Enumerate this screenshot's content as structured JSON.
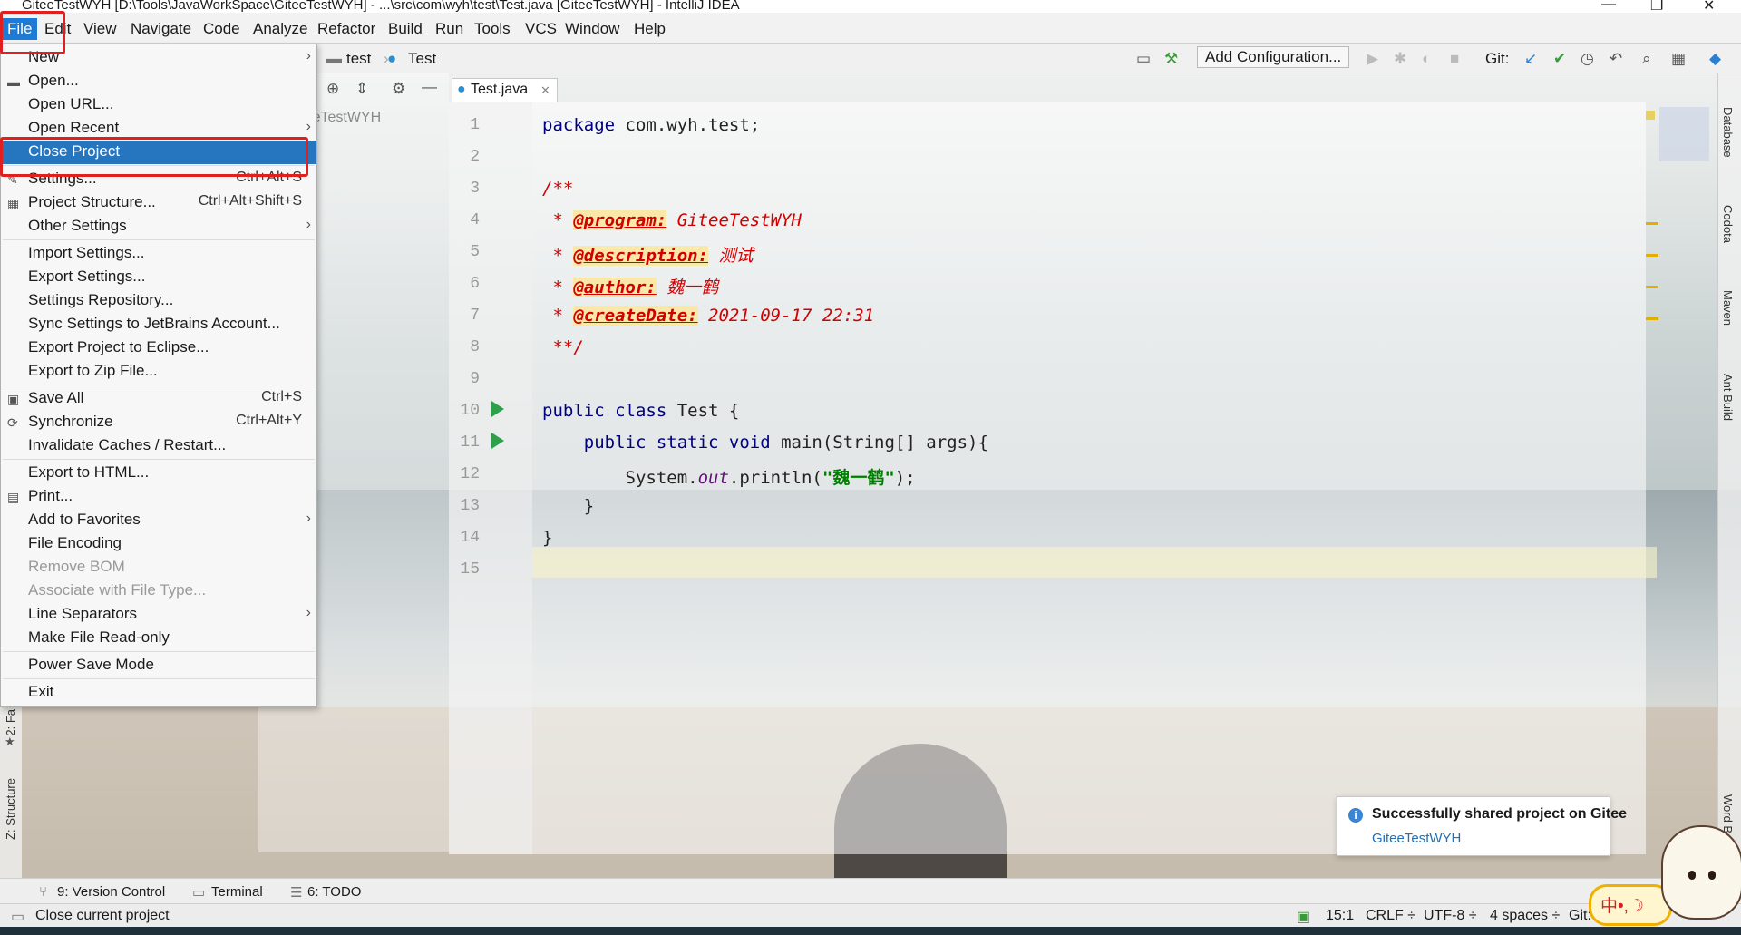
{
  "window": {
    "title": "GiteeTestWYH [D:\\Tools\\JavaWorkSpace\\GiteeTestWYH] - ...\\src\\com\\wyh\\test\\Test.java [GiteeTestWYH] - IntelliJ IDEA"
  },
  "menubar": {
    "items": [
      "File",
      "Edit",
      "View",
      "Navigate",
      "Code",
      "Analyze",
      "Refactor",
      "Build",
      "Run",
      "Tools",
      "VCS",
      "Window",
      "Help"
    ]
  },
  "navbar": {
    "crumb1": "test",
    "crumb2": "Test",
    "add_config": "Add Configuration...",
    "git_label": "Git:"
  },
  "project_panel": {
    "path_fragment": "ace\\GiteeTestWYH"
  },
  "editor": {
    "tab_label": "Test.java",
    "line_numbers": [
      "1",
      "2",
      "3",
      "4",
      "5",
      "6",
      "7",
      "8",
      "9",
      "10",
      "11",
      "12",
      "13",
      "14",
      "15"
    ],
    "lines": {
      "l1_kw": "package",
      "l1_rest": " com.wyh.test;",
      "l3": "/**",
      "l4_star": " * ",
      "l4_tag": "@program:",
      "l4_val": " GiteeTestWYH",
      "l5_star": " * ",
      "l5_tag": "@description:",
      "l5_val": " 测试",
      "l6_star": " * ",
      "l6_tag": "@author:",
      "l6_val": " 魏一鹤",
      "l7_star": " * ",
      "l7_tag": "@createDate:",
      "l7_val": " 2021-09-17 22:31",
      "l8": " **/",
      "l10_kw": "public class",
      "l10_rest": " Test {",
      "l11_kw": "    public static void",
      "l11_rest": " main(String[] args){",
      "l12_pre": "        System.",
      "l12_fld": "out",
      "l12_mid": ".println(",
      "l12_str": "\"魏一鹤\"",
      "l12_end": ");",
      "l13": "    }",
      "l14": "}"
    }
  },
  "file_menu": {
    "items": [
      {
        "label": "New",
        "shortcut": "",
        "arrow": "›"
      },
      {
        "label": "Open...",
        "shortcut": "",
        "arrow": ""
      },
      {
        "label": "Open URL...",
        "shortcut": "",
        "arrow": ""
      },
      {
        "label": "Open Recent",
        "shortcut": "",
        "arrow": "›"
      },
      {
        "label": "Close Project",
        "shortcut": "",
        "arrow": ""
      },
      {
        "label": "Settings...",
        "shortcut": "Ctrl+Alt+S",
        "arrow": ""
      },
      {
        "label": "Project Structure...",
        "shortcut": "Ctrl+Alt+Shift+S",
        "arrow": ""
      },
      {
        "label": "Other Settings",
        "shortcut": "",
        "arrow": "›"
      },
      {
        "label": "Import Settings...",
        "shortcut": "",
        "arrow": ""
      },
      {
        "label": "Export Settings...",
        "shortcut": "",
        "arrow": ""
      },
      {
        "label": "Settings Repository...",
        "shortcut": "",
        "arrow": ""
      },
      {
        "label": "Sync Settings to JetBrains Account...",
        "shortcut": "",
        "arrow": ""
      },
      {
        "label": "Export Project to Eclipse...",
        "shortcut": "",
        "arrow": ""
      },
      {
        "label": "Export to Zip File...",
        "shortcut": "",
        "arrow": ""
      },
      {
        "label": "Save All",
        "shortcut": "Ctrl+S",
        "arrow": ""
      },
      {
        "label": "Synchronize",
        "shortcut": "Ctrl+Alt+Y",
        "arrow": ""
      },
      {
        "label": "Invalidate Caches / Restart...",
        "shortcut": "",
        "arrow": ""
      },
      {
        "label": "Export to HTML...",
        "shortcut": "",
        "arrow": ""
      },
      {
        "label": "Print...",
        "shortcut": "",
        "arrow": ""
      },
      {
        "label": "Add to Favorites",
        "shortcut": "",
        "arrow": "›"
      },
      {
        "label": "File Encoding",
        "shortcut": "",
        "arrow": ""
      },
      {
        "label": "Remove BOM",
        "shortcut": "",
        "arrow": ""
      },
      {
        "label": "Associate with File Type...",
        "shortcut": "",
        "arrow": ""
      },
      {
        "label": "Line Separators",
        "shortcut": "",
        "arrow": "›"
      },
      {
        "label": "Make File Read-only",
        "shortcut": "",
        "arrow": ""
      },
      {
        "label": "Power Save Mode",
        "shortcut": "",
        "arrow": ""
      },
      {
        "label": "Exit",
        "shortcut": "",
        "arrow": ""
      }
    ]
  },
  "tool_windows": {
    "version_control": "9: Version Control",
    "terminal": "Terminal",
    "todo": "6: TODO"
  },
  "statusbar": {
    "message": "Close current project",
    "position": "15:1",
    "line_sep": "CRLF ÷",
    "encoding": "UTF-8 ÷",
    "indent": "4 spaces ÷",
    "vcs": "Git:"
  },
  "right_sidebar": {
    "database": "Database",
    "codota": "Codota",
    "maven": "Maven",
    "ant": "Ant Build",
    "word": "Word Bo"
  },
  "left_sidebar": {
    "favorites": "2: Fa",
    "structure": "Z: Structure"
  },
  "notification": {
    "title": "Successfully shared project on Gitee",
    "link": "GiteeTestWYH"
  },
  "ime": {
    "text": "中•,☽"
  },
  "colors": {
    "menu_selected": "#2675bf",
    "annotation_red": "#e02020",
    "run_green": "#2da04a",
    "doc_red": "#d20000"
  }
}
